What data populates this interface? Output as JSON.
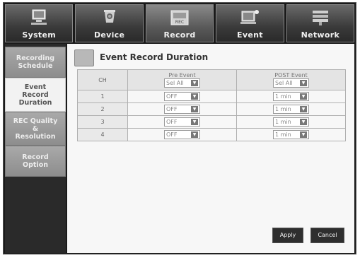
{
  "tabs": [
    {
      "label": "System",
      "icon": "monitor-icon"
    },
    {
      "label": "Device",
      "icon": "camera-icon"
    },
    {
      "label": "Record",
      "icon": "rec-icon",
      "active": true
    },
    {
      "label": "Event",
      "icon": "event-icon"
    },
    {
      "label": "Network",
      "icon": "network-icon"
    }
  ],
  "sidebar": {
    "items": [
      {
        "label": "Recording\nSchedule"
      },
      {
        "label": "Event\nRecord\nDuration",
        "active": true
      },
      {
        "label": "REC Quality\n&\nResolution"
      },
      {
        "label": "Record\nOption"
      }
    ]
  },
  "page": {
    "title": "Event Record Duration"
  },
  "table": {
    "ch_header": "CH",
    "pre_header": "Pre Event",
    "post_header": "POST Event",
    "pre_all": "Sel All",
    "post_all": "Sel All",
    "rows": [
      {
        "ch": "1",
        "pre": "OFF",
        "post": "1 min"
      },
      {
        "ch": "2",
        "pre": "OFF",
        "post": "1 min"
      },
      {
        "ch": "3",
        "pre": "OFF",
        "post": "1 min"
      },
      {
        "ch": "4",
        "pre": "OFF",
        "post": "1 min"
      }
    ]
  },
  "buttons": {
    "apply": "Apply",
    "cancel": "Cancel"
  }
}
